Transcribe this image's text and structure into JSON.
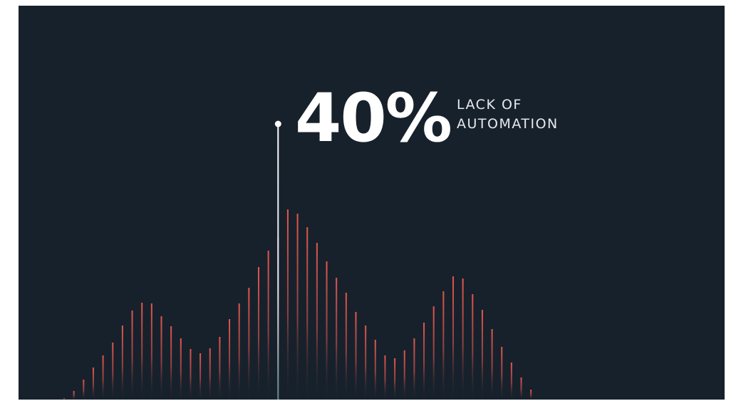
{
  "highlight": {
    "value": "40%",
    "label_line1": "LACK OF",
    "label_line2": "AUTOMATION"
  },
  "colors": {
    "background": "#17212c",
    "bar_top": "#e4574d",
    "bar_bottom": "#17212c",
    "marker": "#ffffff",
    "text": "#ffffff"
  },
  "chart_data": {
    "type": "bar",
    "values": [
      2,
      12,
      28,
      45,
      62,
      80,
      104,
      125,
      136,
      135,
      117,
      103,
      86,
      71,
      65,
      72,
      88,
      113,
      135,
      157,
      186,
      209,
      228,
      267,
      261,
      242,
      220,
      194,
      171,
      150,
      123,
      104,
      84,
      62,
      58,
      69,
      86,
      108,
      131,
      152,
      173,
      170,
      148,
      126,
      99,
      74,
      52,
      31,
      14
    ],
    "highlight_index": 22,
    "highlight_value": 40,
    "grid": false,
    "legend": "none"
  }
}
